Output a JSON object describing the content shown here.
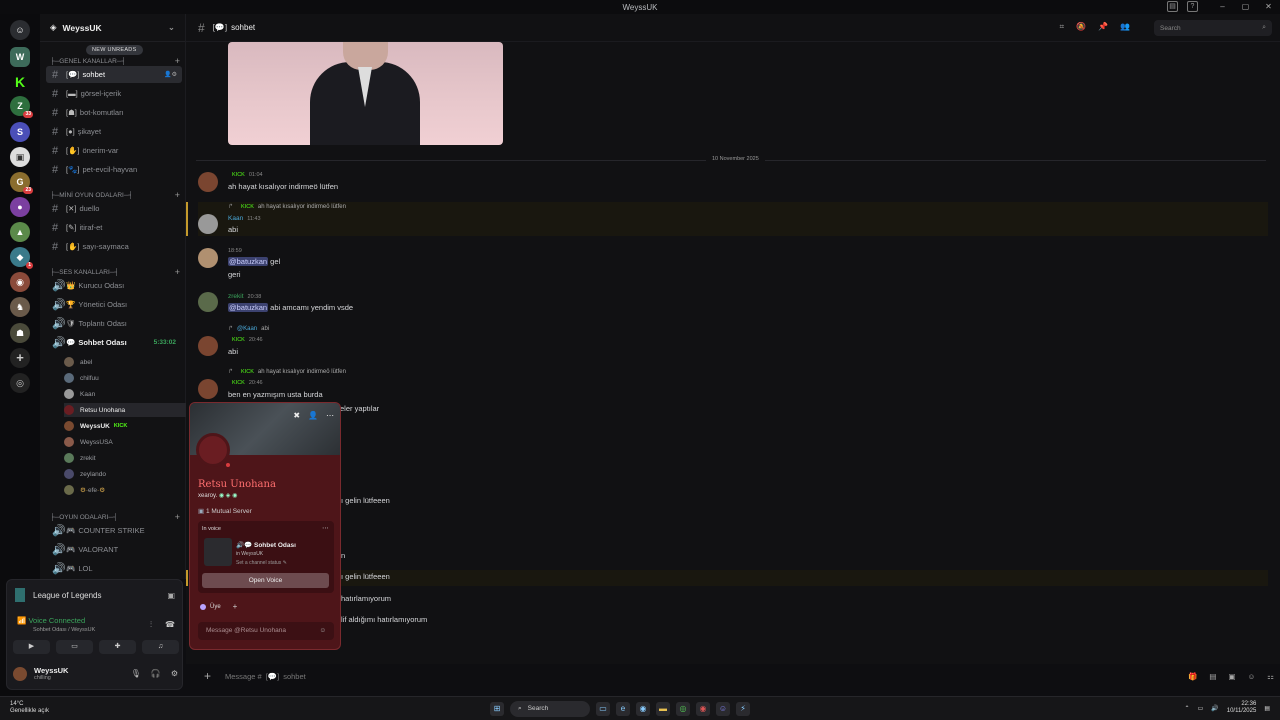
{
  "window": {
    "title": "WeyssUK"
  },
  "server": {
    "name": "WeyssUK",
    "new_unreads": "NEW UNREADS"
  },
  "guild_badges": [
    "33",
    "23",
    "1"
  ],
  "categories": {
    "genel": "GENEL KANALLAR",
    "mini": "MİNİ OYUN ODALARI",
    "ses": "SES KANALLARI",
    "oyun": "OYUN ODALARI"
  },
  "channels": {
    "sohbet": "sohbet",
    "gorsel": "görsel-içerik",
    "bot": "bot-komutları",
    "sikayet": "şikayet",
    "oneri": "önerim-var",
    "pet": "pet-evcil-hayvan",
    "duello": "duello",
    "itiraf": "itiraf-et",
    "sayi": "sayı-saymaca"
  },
  "voice_channels": {
    "kurucu": "Kurucu Odası",
    "yonetici": "Yönetici Odası",
    "toplanti": "Toplantı Odası",
    "sohbet": "Sohbet Odası",
    "sohbet_timer": "5:33:02",
    "cs": "COUNTER STRIKE",
    "valorant": "VALORANT",
    "lol": "LOL"
  },
  "voice_users": {
    "u1": "abel",
    "u2": "chilfuu",
    "u3": "Kaan",
    "u4": "Retsu Unohana",
    "u5": "WeyssUK",
    "u6": "WeyssUSA",
    "u7": "zrekit",
    "u8": "zeylando",
    "u9": "efe"
  },
  "kick_label": "KICK",
  "voice_panel": {
    "activity": "League of Legends",
    "status": "Voice Connected",
    "sub": "Sohbet Odası / WeyssUK"
  },
  "current_user": {
    "name": "WeyssUK",
    "status": "chilling"
  },
  "chat_header": {
    "channel": "sohbet",
    "search_placeholder": "Search"
  },
  "day_divider": "10 November 2025",
  "messages": {
    "m1": {
      "time": "01:04",
      "text": "ah hayat kısalıyor indirmeö lütfen"
    },
    "m2": {
      "author": "Kaan",
      "time": "11:43",
      "reply": "ah hayat kısalıyor indirmeö lütfen",
      "text": "abi"
    },
    "m3": {
      "time": "18:59",
      "mention": "@batuzkan",
      "text": "gel",
      "text2": "geri"
    },
    "m4": {
      "author": "zrekit",
      "time": "20:38",
      "mention": "@batuzkan",
      "text": "abi amcamı yendim vsde"
    },
    "m5": {
      "reply_mention": "@Kaan",
      "reply": "abi",
      "time": "20:46",
      "text": "abi"
    },
    "m6": {
      "reply": "ah hayat kısalıyor indirmeö lütfen",
      "time": "20:46",
      "text": "ben en yazmışım usta burda",
      "tail": "eler yaptılar"
    },
    "m7": {
      "tail": "ı gelin lütfeeen"
    },
    "m8": {
      "tail": "n"
    },
    "m9": {
      "tail": "ı gelin lütfeeen"
    },
    "m10": {
      "tail": "hatırlamıyorum"
    },
    "m11": {
      "tail": "lif aldığımı hatırlamıyorum"
    }
  },
  "composer": {
    "placeholder": "Message #",
    "channel": "sohbet"
  },
  "profile": {
    "name": "Retsu Unohana",
    "username": "xearoy.",
    "mutual": "1 Mutual Server",
    "in_voice": "In voice",
    "voice_channel": "Sohbet Odası",
    "voice_server": "in WeyssUK",
    "channel_status": "Set a channel status",
    "open_voice": "Open Voice",
    "role": "Üye",
    "message_placeholder": "Message @Retsu Unohana"
  },
  "taskbar": {
    "temp": "14°C",
    "weather": "Genellikle açık",
    "search": "Search",
    "time": "22:36",
    "date": "10/11/2025"
  }
}
